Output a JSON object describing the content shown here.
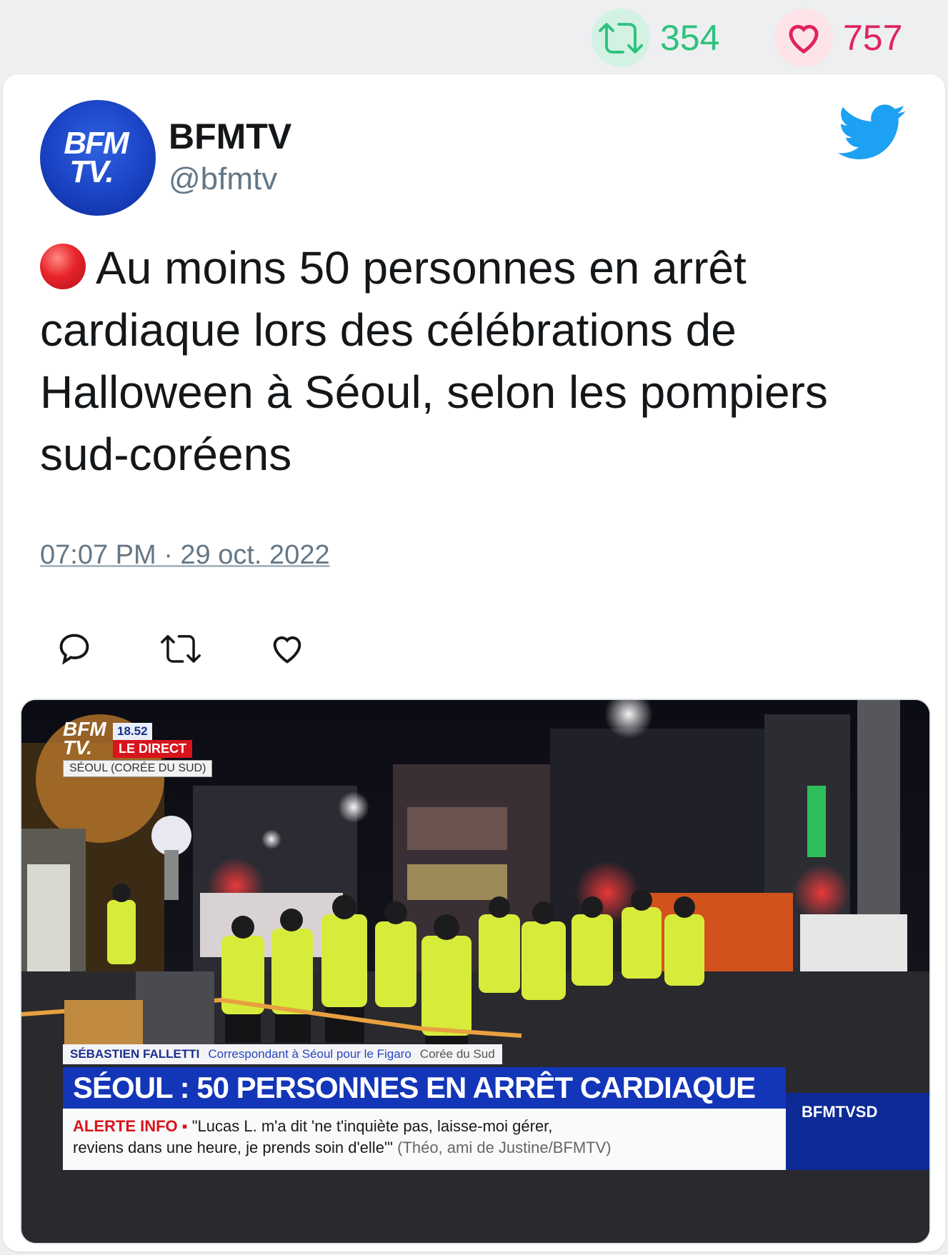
{
  "stats": {
    "retweets": "354",
    "likes": "757",
    "retweet_color": "#2ec27e",
    "like_color": "#e0245e"
  },
  "tweet": {
    "author_name": "BFMTV",
    "handle": "@bfmtv",
    "avatar_text": [
      "BFM",
      "TV."
    ],
    "emoji": "red-circle",
    "text": "Au moins 50 personnes en arrêt cardiaque lors des célébrations de Halloween à Séoul, selon les pompiers sud-coréens",
    "timestamp": "07:07 PM · 29 oct. 2022",
    "actions": [
      "reply-icon",
      "retweet-icon",
      "like-icon"
    ],
    "platform_icon": "twitter-bird-icon",
    "brand_color": "#1da1f2"
  },
  "media": {
    "logo_lines": [
      "BFM",
      "TV."
    ],
    "time": "18.52",
    "live_label": "LE DIRECT",
    "location": "SÉOUL (CORÉE DU SUD)",
    "speaker_name": "SÉBASTIEN FALLETTI",
    "speaker_role": "Correspondant à Séoul pour le Figaro",
    "speaker_place": "Corée du Sud",
    "headline": "SÉOUL : 50 PERSONNES EN ARRÊT CARDIAQUE",
    "alert_label": "ALERTE INFO",
    "alert_text_1": "\"Lucas L. m'a dit 'ne t'inquiète pas, laisse-moi gérer,",
    "alert_text_2": "reviens dans une heure, je prends soin d'elle'\"",
    "alert_source": "(Théo, ami de Justine/BFMTV)",
    "channel": "BFMTVSD"
  }
}
